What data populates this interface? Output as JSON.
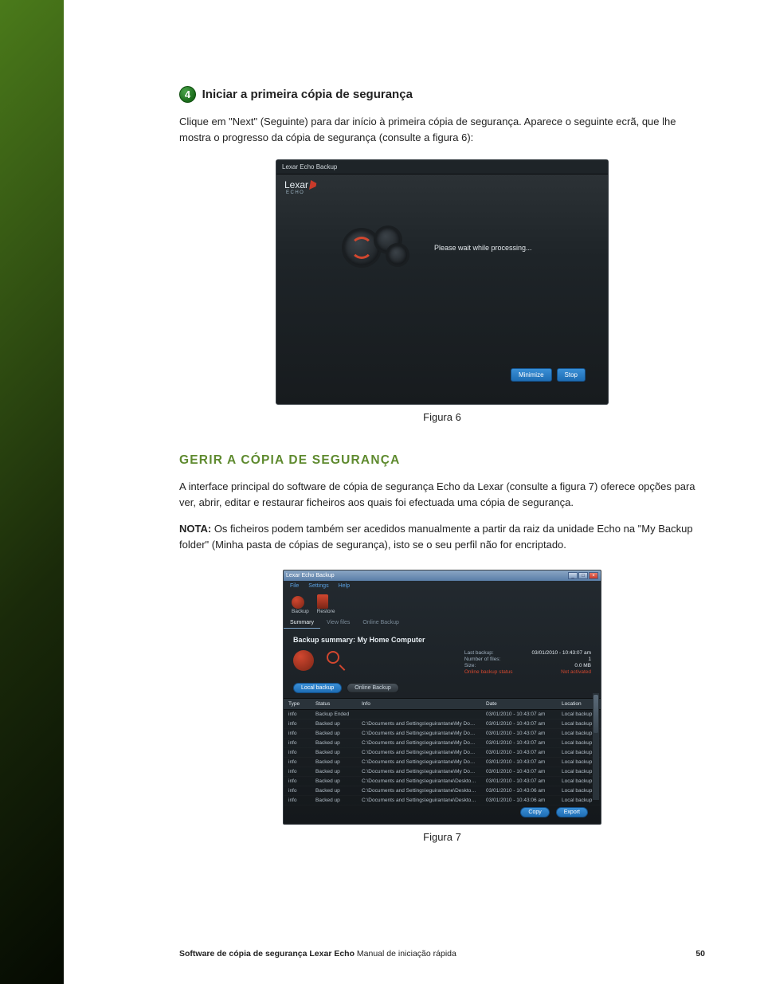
{
  "step": {
    "badge": "4",
    "title": "Iniciar a primeira cópia de segurança",
    "paragraph": "Clique em \"Next\" (Seguinte) para dar início à primeira cópia de segurança. Aparece o seguinte ecrã, que lhe mostra o progresso da cópia de segurança (consulte a figura 6):"
  },
  "figure6": {
    "window_title": "Lexar Echo Backup",
    "logo_text": "Lexar",
    "logo_sub": "ECHO",
    "processing": "Please wait while processing...",
    "btn_minimize": "Minimize",
    "btn_stop": "Stop",
    "caption": "Figura 6"
  },
  "section_heading": "GERIR A CÓPIA DE SEGURANÇA",
  "section_para": "A interface principal do software de cópia de segurança Echo da Lexar (consulte a figura 7) oferece opções para ver, abrir, editar e restaurar ficheiros aos quais foi efectuada uma cópia de segurança.",
  "note_label": "NOTA:",
  "note_text": " Os ficheiros podem também ser acedidos manualmente a partir da raiz da unidade Echo na \"My Backup folder\" (Minha pasta de cópias de segurança), isto se o seu perfil não for encriptado.",
  "figure7": {
    "window_title": "Lexar Echo Backup",
    "menu": [
      "File",
      "Settings",
      "Help"
    ],
    "toolbar_labels": [
      "Backup",
      "Restore"
    ],
    "tabs": [
      "Summary",
      "View files",
      "Online Backup"
    ],
    "summary_title": "Backup summary: My Home Computer",
    "status": {
      "last_backup_k": "Last backup:",
      "last_backup_v": "03/01/2010 - 10:43:07 am",
      "num_files_k": "Number of files:",
      "num_files_v": "1",
      "size_k": "Size:",
      "size_v": "0.0 MB",
      "online_k": "Online backup status",
      "online_v": "Not activated"
    },
    "subbtn_local": "Local backup",
    "subbtn_online": "Online Backup",
    "columns": [
      "Type",
      "Status",
      "Info",
      "Date",
      "Location"
    ],
    "rows": [
      {
        "type": "info",
        "status": "Backup Ended",
        "info": "",
        "date": "03/01/2010 - 10:43:07 am",
        "loc": "Local backup"
      },
      {
        "type": "info",
        "status": "Backed up",
        "info": "C:\\Documents and Settings\\eguirantane\\My Documents\\...",
        "date": "03/01/2010 - 10:43:07 am",
        "loc": "Local backup"
      },
      {
        "type": "info",
        "status": "Backed up",
        "info": "C:\\Documents and Settings\\eguirantane\\My Documents\\...",
        "date": "03/01/2010 - 10:43:07 am",
        "loc": "Local backup"
      },
      {
        "type": "info",
        "status": "Backed up",
        "info": "C:\\Documents and Settings\\eguirantane\\My Documents\\...",
        "date": "03/01/2010 - 10:43:07 am",
        "loc": "Local backup"
      },
      {
        "type": "info",
        "status": "Backed up",
        "info": "C:\\Documents and Settings\\eguirantane\\My Documents\\...",
        "date": "03/01/2010 - 10:43:07 am",
        "loc": "Local backup"
      },
      {
        "type": "info",
        "status": "Backed up",
        "info": "C:\\Documents and Settings\\eguirantane\\My Documents\\...",
        "date": "03/01/2010 - 10:43:07 am",
        "loc": "Local backup"
      },
      {
        "type": "info",
        "status": "Backed up",
        "info": "C:\\Documents and Settings\\eguirantane\\My Documents\\...",
        "date": "03/01/2010 - 10:43:07 am",
        "loc": "Local backup"
      },
      {
        "type": "info",
        "status": "Backed up",
        "info": "C:\\Documents and Settings\\eguirantane\\Desktop\\Africa...",
        "date": "03/01/2010 - 10:43:07 am",
        "loc": "Local backup"
      },
      {
        "type": "info",
        "status": "Backed up",
        "info": "C:\\Documents and Settings\\eguirantane\\Desktop\\Picture...",
        "date": "03/01/2010 - 10:43:06 am",
        "loc": "Local backup"
      },
      {
        "type": "info",
        "status": "Backed up",
        "info": "C:\\Documents and Settings\\eguirantane\\Desktop\\Online...",
        "date": "03/01/2010 - 10:43:06 am",
        "loc": "Local backup"
      }
    ],
    "btn_copy": "Copy",
    "btn_export": "Export",
    "caption": "Figura 7"
  },
  "footer": {
    "product_bold": "Software de cópia de segurança Lexar Echo",
    "product_reg": " Manual de iniciação rápida",
    "page": "50"
  }
}
